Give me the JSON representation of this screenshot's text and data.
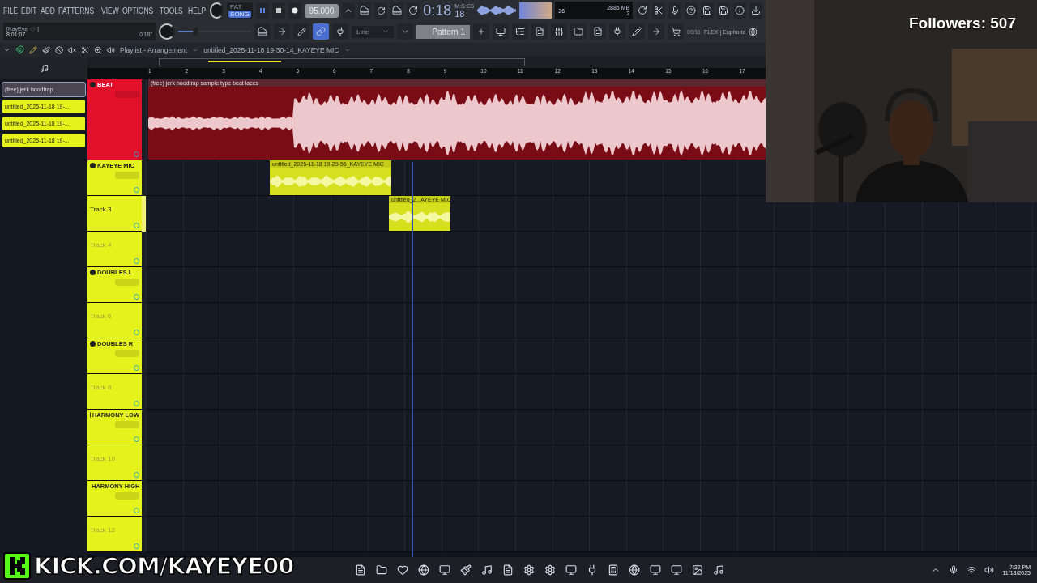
{
  "menu": [
    "FILE",
    "EDIT",
    "ADD",
    "PATTERNS",
    "VIEW",
    "OPTIONS",
    "TOOLS",
    "HELP"
  ],
  "hint": {
    "title": "[KayEye",
    "close": "]",
    "time": "8:01:07",
    "duration": "0'18''"
  },
  "transport": {
    "modes": [
      {
        "label": "PAT",
        "selected": false
      },
      {
        "label": "SONG",
        "selected": true
      }
    ],
    "tempo": "95.000",
    "time": "0:18",
    "time_cs": "18",
    "time_unit": "M:S:CS"
  },
  "monitor": {
    "cpu": "26",
    "memory": "2885 MB",
    "polyphony": "2"
  },
  "volume": {
    "level": 0.22
  },
  "snap": "Line",
  "pattern": "Pattern 1",
  "news": {
    "count": "09/11",
    "text": "FLEX | Euphoria"
  },
  "playlist": {
    "title": "Playlist - Arrangement",
    "subtitle": "untitled_2025-11-18 19-30-14_KAYEYE MIC",
    "ruler": [
      "1",
      "2",
      "3",
      "4",
      "5",
      "6",
      "7",
      "8",
      "9",
      "10",
      "11",
      "12",
      "13",
      "14",
      "15",
      "16",
      "17"
    ],
    "clip_list": [
      {
        "label": "(free) jerk  hoodtrap..",
        "kind": "beat",
        "selected": true
      },
      {
        "label": "untitled_2025-11-18 19-...",
        "kind": "vocal",
        "selected": false
      },
      {
        "label": "untitled_2025-11-18 19-...",
        "kind": "vocal",
        "selected": false
      },
      {
        "label": "untitled_2025-11-18 19-...",
        "kind": "vocal",
        "selected": false
      }
    ],
    "tracks": [
      {
        "name": "BEAT",
        "kind": "named",
        "color": "#e3102c",
        "selected": false,
        "clips": [
          {
            "label": "(free) jerk  hoodtrap  sample type beat laces",
            "kind": "beat"
          }
        ]
      },
      {
        "name": "KAYEYE MIC",
        "kind": "named",
        "color": "#e6f21c",
        "selected": false,
        "clips": [
          {
            "label": "untitled_2025-11-18 19-29-56_KAYEYE MIC",
            "kind": "vocal"
          }
        ]
      },
      {
        "name": "Track 3",
        "kind": "plain",
        "color": "#e6f21c",
        "selected": true,
        "clips": [
          {
            "label": "untitled_2...AYEYE MIC",
            "kind": "vocal"
          }
        ]
      },
      {
        "name": "Track 4",
        "kind": "plain",
        "color": "#e6f21c",
        "selected": false
      },
      {
        "name": "DOUBLES L",
        "kind": "named",
        "color": "#e6f21c",
        "selected": false
      },
      {
        "name": "Track 6",
        "kind": "plain",
        "color": "#e6f21c",
        "selected": false
      },
      {
        "name": "DOUBLES R",
        "kind": "named",
        "color": "#e6f21c",
        "selected": false
      },
      {
        "name": "Track 8",
        "kind": "plain",
        "color": "#e6f21c",
        "selected": false
      },
      {
        "name": "HARMONY LOW",
        "kind": "named",
        "color": "#e6f21c",
        "selected": false
      },
      {
        "name": "Track 10",
        "kind": "plain",
        "color": "#e6f21c",
        "selected": false
      },
      {
        "name": "HARMONY HIGH",
        "kind": "named",
        "color": "#e6f21c",
        "selected": false
      },
      {
        "name": "Track 12",
        "kind": "plain",
        "color": "#e6f21c",
        "selected": false
      }
    ]
  },
  "overlay": {
    "followers": "Followers: 507",
    "channel": "KICK.COM/KAYEYE00"
  },
  "taskbar": {
    "time": "7:32 PM",
    "date": "11/18/2025"
  }
}
